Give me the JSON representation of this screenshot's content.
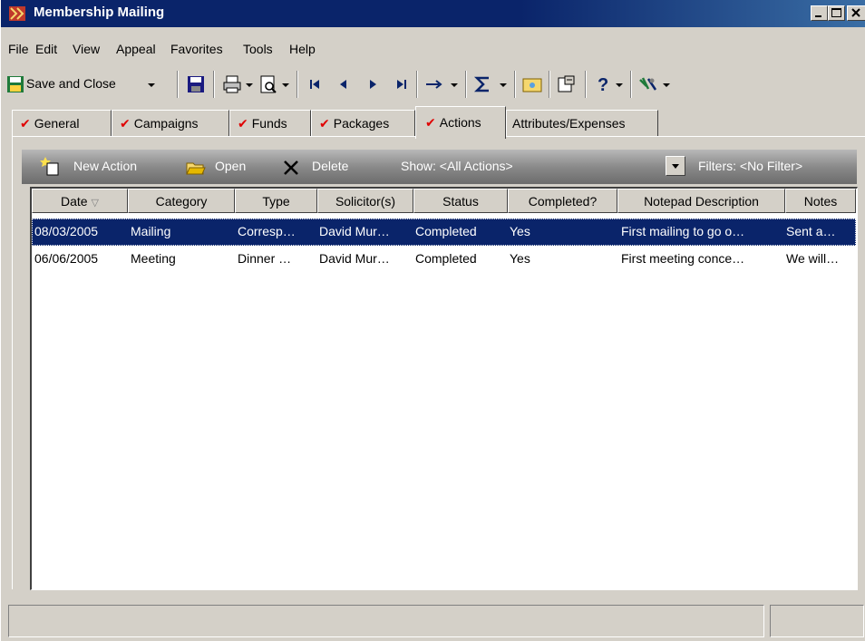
{
  "window": {
    "title": "Membership Mailing"
  },
  "menu": [
    "File",
    "Edit",
    "View",
    "Appeal",
    "Favorites",
    "Tools",
    "Help"
  ],
  "toolbar": {
    "save_close_label": "Save and Close"
  },
  "tabs": [
    {
      "label": "General",
      "checked": true
    },
    {
      "label": "Campaigns",
      "checked": true
    },
    {
      "label": "Funds",
      "checked": true
    },
    {
      "label": "Packages",
      "checked": true
    },
    {
      "label": "Actions",
      "checked": true,
      "active": true
    },
    {
      "label": "Attributes/Expenses",
      "checked": false
    }
  ],
  "actionbar": {
    "new_action": "New Action",
    "open": "Open",
    "delete": "Delete",
    "show": "Show: <All Actions>",
    "filters": "Filters: <No Filter>"
  },
  "grid": {
    "columns": [
      "Date",
      "Category",
      "Type",
      "Solicitor(s)",
      "Status",
      "Completed?",
      "Notepad Description",
      "Notes"
    ],
    "rows": [
      {
        "date": "08/03/2005",
        "category": "Mailing",
        "type": "Corresp…",
        "solicitor": "David Mur…",
        "status": "Completed",
        "completed": "Yes",
        "notepad": "First mailing to go o…",
        "notes": "Sent a…",
        "selected": true
      },
      {
        "date": "06/06/2005",
        "category": "Meeting",
        "type": "Dinner …",
        "solicitor": "David Mur…",
        "status": "Completed",
        "completed": "Yes",
        "notepad": "First meeting conce…",
        "notes": "We will…",
        "selected": false
      }
    ]
  },
  "colors": {
    "titlebar": "#0a246a",
    "selection": "#0a246a",
    "face": "#d4d0c8",
    "check": "#e00000"
  }
}
